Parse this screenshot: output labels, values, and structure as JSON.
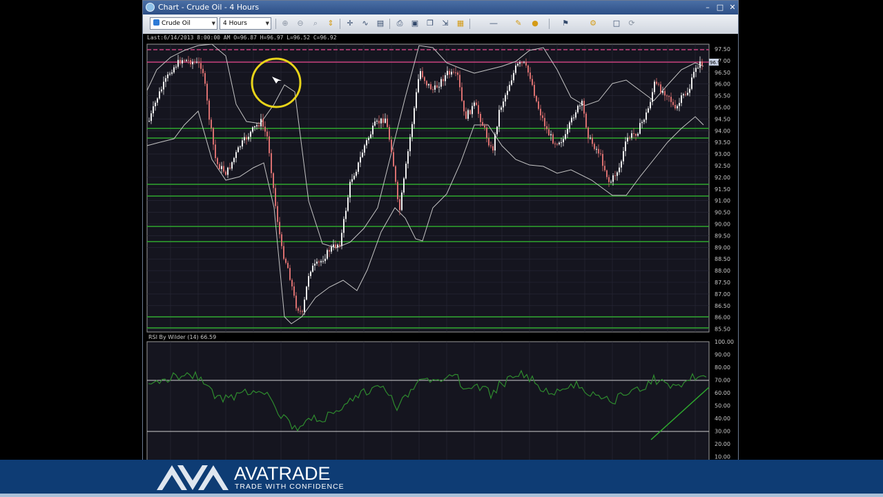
{
  "window": {
    "title": "Chart - Crude Oil - 4 Hours",
    "controls": [
      "–",
      "□",
      "✕"
    ]
  },
  "toolbar": {
    "symbol": "Crude Oil",
    "timeframe": "4 Hours",
    "tools": [
      "zoom-in-icon",
      "zoom-out-icon",
      "zoom-fit-icon",
      "cursor-icon",
      "crosshair-icon",
      "indicators-icon",
      "templates-icon",
      "print-icon",
      "save-icon",
      "copy-icon",
      "export-icon",
      "image-icon",
      "line-style-icon",
      "draw-icon",
      "color-icon",
      "objects-icon",
      "settings-icon",
      "tile-icon",
      "refresh-icon"
    ]
  },
  "info": {
    "last": "Last:6/14/2013 8:00:00 AM O=96.87 H=96.97 L=96.52 C=96.92"
  },
  "price_axis": {
    "labels": [
      "97.50",
      "97.00",
      "96.50",
      "96.00",
      "95.50",
      "95.00",
      "94.50",
      "94.00",
      "93.50",
      "93.00",
      "92.50",
      "92.00",
      "91.50",
      "91.00",
      "90.50",
      "90.00",
      "89.50",
      "89.00",
      "88.50",
      "88.00",
      "87.50",
      "87.00",
      "86.50",
      "86.00",
      "85.50"
    ],
    "current": "96.92"
  },
  "rsi": {
    "label": "RSI By Wilder (14) 66.59",
    "axis_labels": [
      "100.00",
      "90.00",
      "80.00",
      "70.00",
      "60.00",
      "50.00",
      "40.00",
      "30.00",
      "20.00",
      "10.00"
    ]
  },
  "colors": {
    "up": "#eeeeee",
    "down": "#d96f6f",
    "support": "#2ea82e",
    "resistance": "#c9437e",
    "bands": "#c4c4c4",
    "rsi": "#2e8b2e",
    "highlight": "#e8d41a",
    "footer": "#0e3c74"
  },
  "brand": {
    "name": "AVATRADE",
    "tagline": "TRADE WITH CONFIDENCE"
  }
}
